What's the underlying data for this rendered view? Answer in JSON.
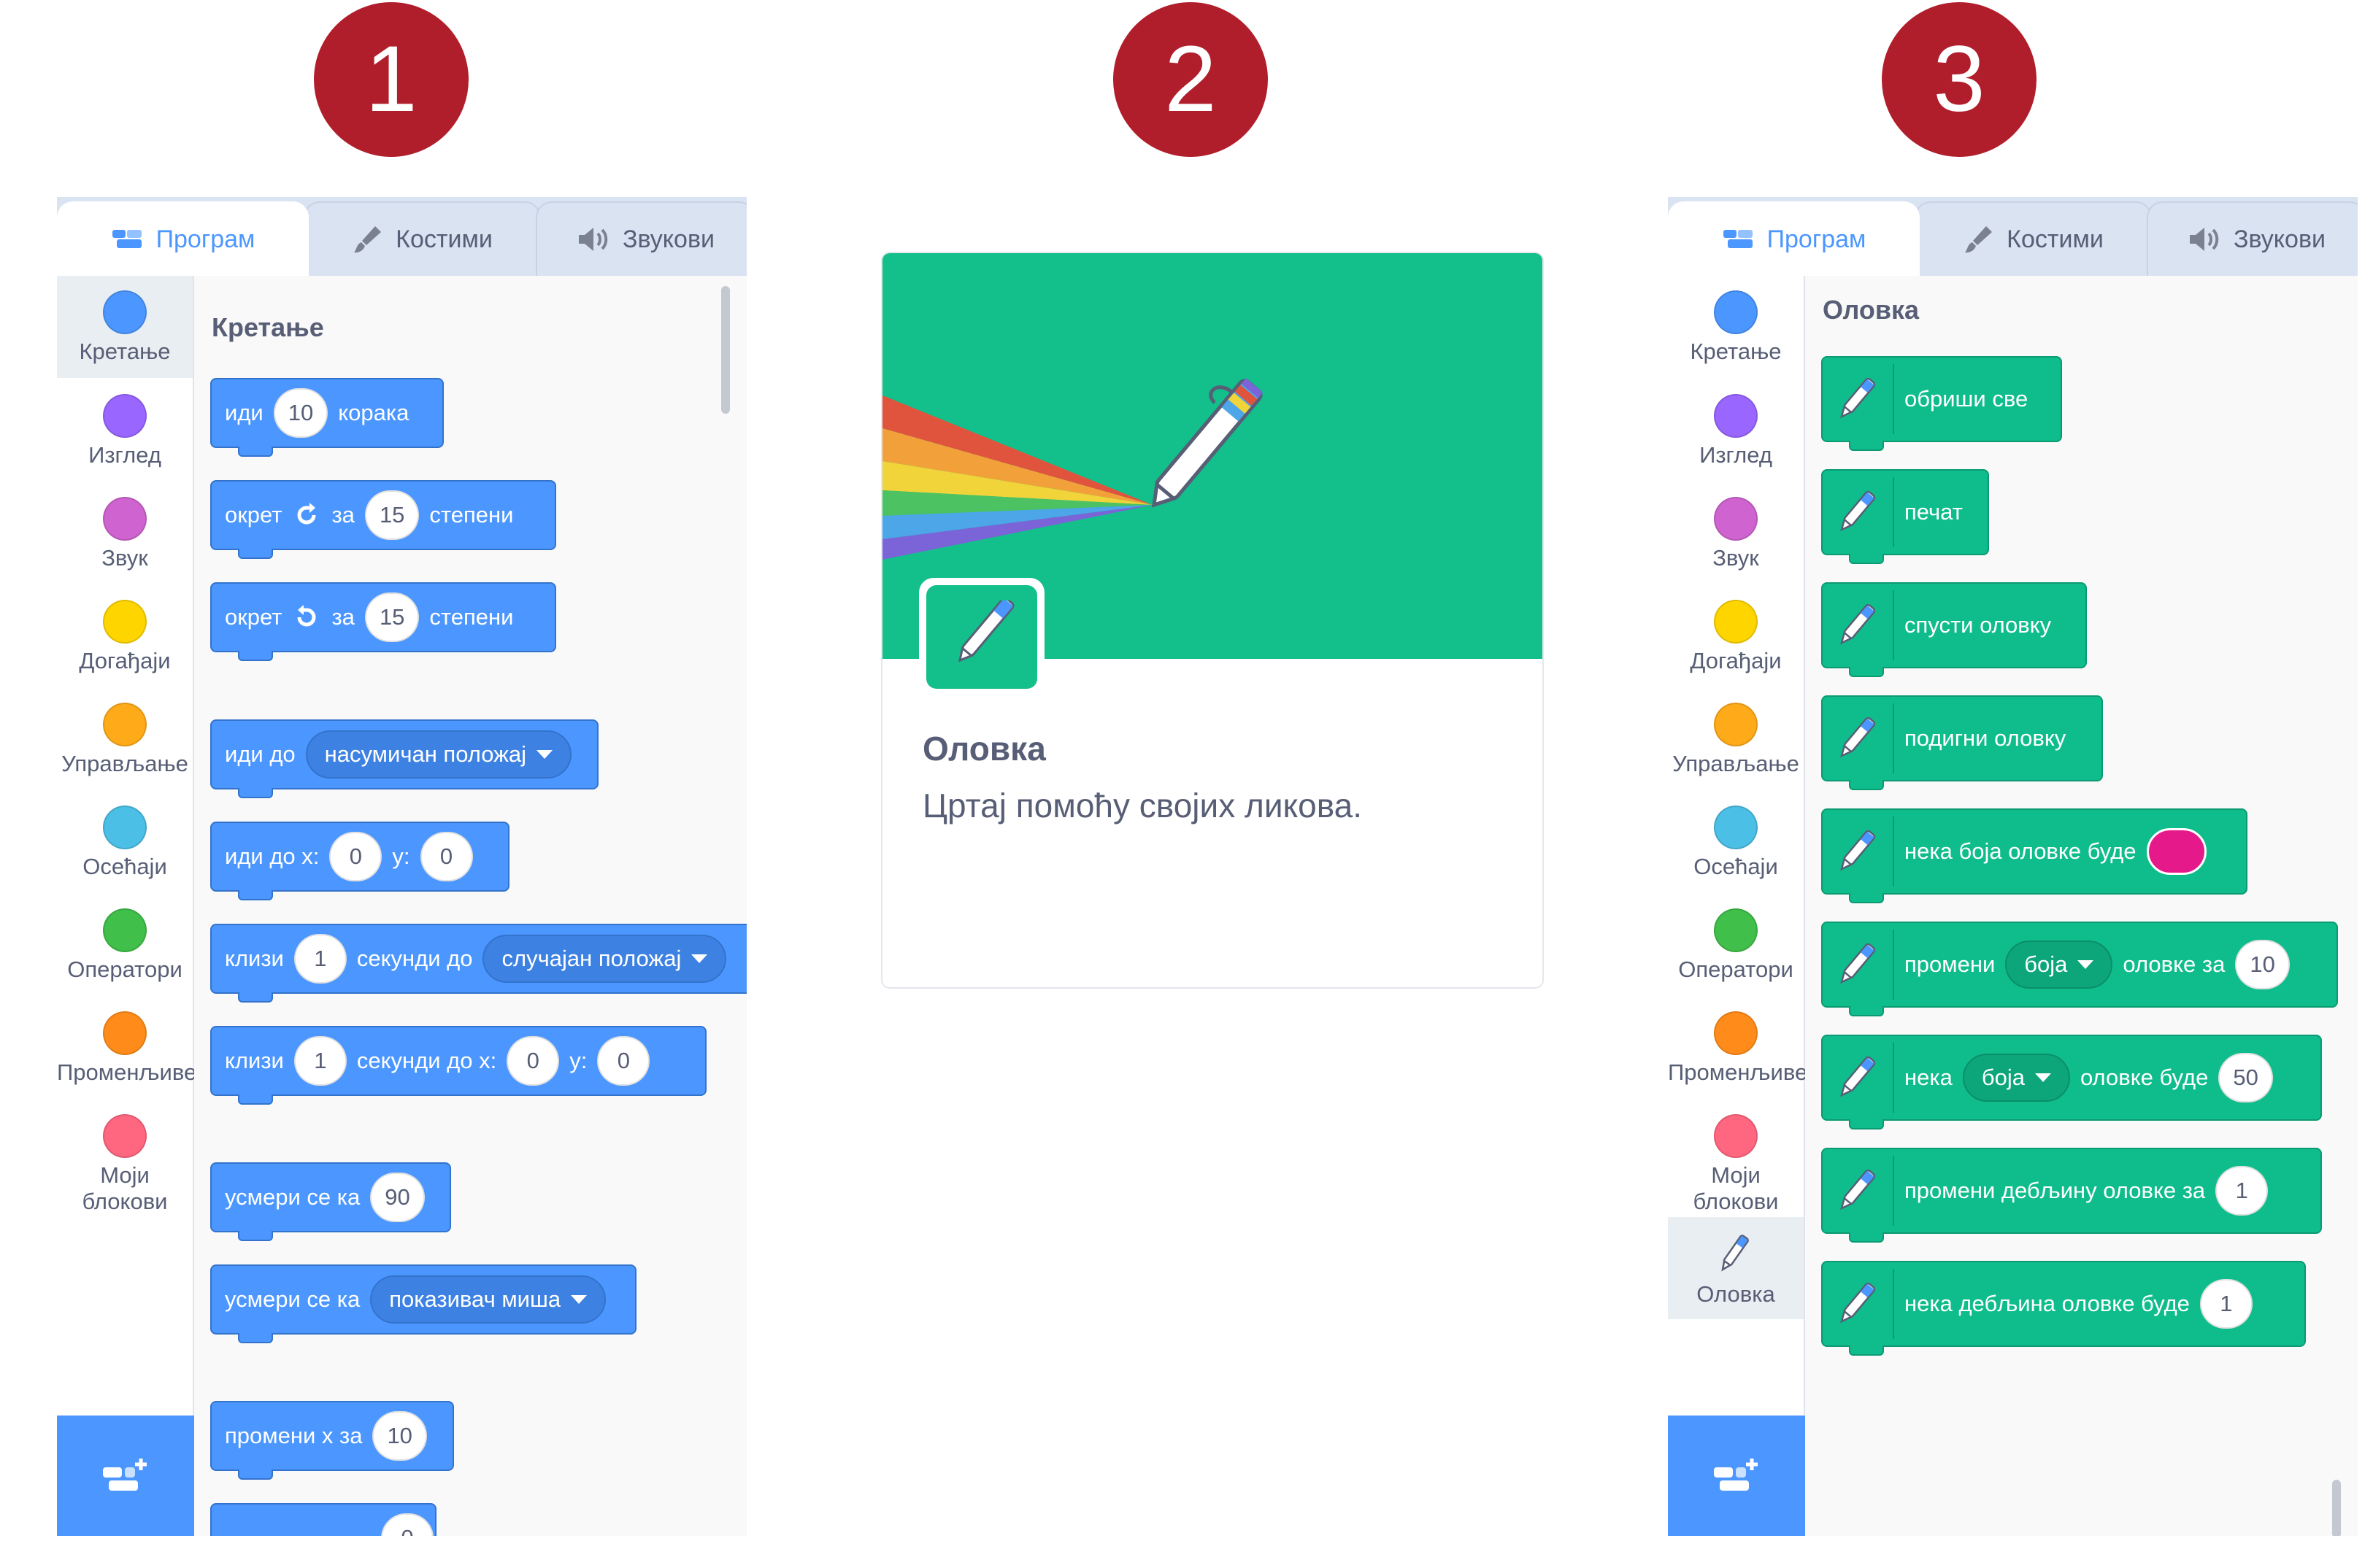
{
  "badges": [
    "1",
    "2",
    "3"
  ],
  "colors": {
    "badge": "#b01e2b",
    "motion": "#4c97ff",
    "looks": "#9966ff",
    "sound": "#cf63cf",
    "events": "#ffd500",
    "control": "#ffab19",
    "sensing": "#4cbfe6",
    "operators": "#40bf4a",
    "variables": "#ff8c1a",
    "myblocks": "#ff6680",
    "pen": "#0fbd8c",
    "pen_color_swatch": "#e6198a"
  },
  "tabs": {
    "code": "Програм",
    "costumes": "Костими",
    "sounds": "Звукови"
  },
  "categories": [
    "Кретање",
    "Изглед",
    "Звук",
    "Догађаји",
    "Управљање",
    "Осећаји",
    "Оператори",
    "Променљиве",
    "Моји блокови",
    "Оловка"
  ],
  "panel1": {
    "section_title": "Кретање",
    "move": {
      "a": "иди",
      "steps": "10",
      "b": "корака"
    },
    "turn_right": {
      "a": "окрет",
      "b": "за",
      "deg": "15",
      "c": "степени"
    },
    "turn_left": {
      "a": "окрет",
      "b": "за",
      "deg": "15",
      "c": "степени"
    },
    "goto": {
      "a": "иди до",
      "menu": "насумичан положај"
    },
    "goto_xy": {
      "a": "иди до x:",
      "x": "0",
      "b": "y:",
      "y": "0"
    },
    "glide": {
      "a": "клизи",
      "secs": "1",
      "b": "секунди до",
      "menu": "случајан положај"
    },
    "glide_xy": {
      "a": "клизи",
      "secs": "1",
      "b": "секунди до x:",
      "x": "0",
      "c": "y:",
      "y": "0"
    },
    "point_dir": {
      "a": "усмери се ка",
      "deg": "90"
    },
    "point_towards": {
      "a": "усмери се ка",
      "menu": "показивач миша"
    },
    "change_x": {
      "a": "промени x за",
      "val": "10"
    },
    "partial": {
      "val": "0"
    }
  },
  "card": {
    "title": "Оловка",
    "description": "Цртај помоћу својих ликова."
  },
  "panel3": {
    "section_title": "Оловка",
    "erase_all": "обриши све",
    "stamp": "печат",
    "pen_down": "спусти оловку",
    "pen_up": "подигни оловку",
    "set_color": "нека боја оловке буде",
    "change_param": {
      "a": "промени",
      "menu": "боја",
      "b": "оловке за",
      "val": "10"
    },
    "set_param": {
      "a": "нека",
      "menu": "боја",
      "b": "оловке буде",
      "val": "50"
    },
    "change_size": {
      "a": "промени дебљину оловке за",
      "val": "1"
    },
    "set_size": {
      "a": "нека дебљина оловке буде",
      "val": "1"
    }
  }
}
